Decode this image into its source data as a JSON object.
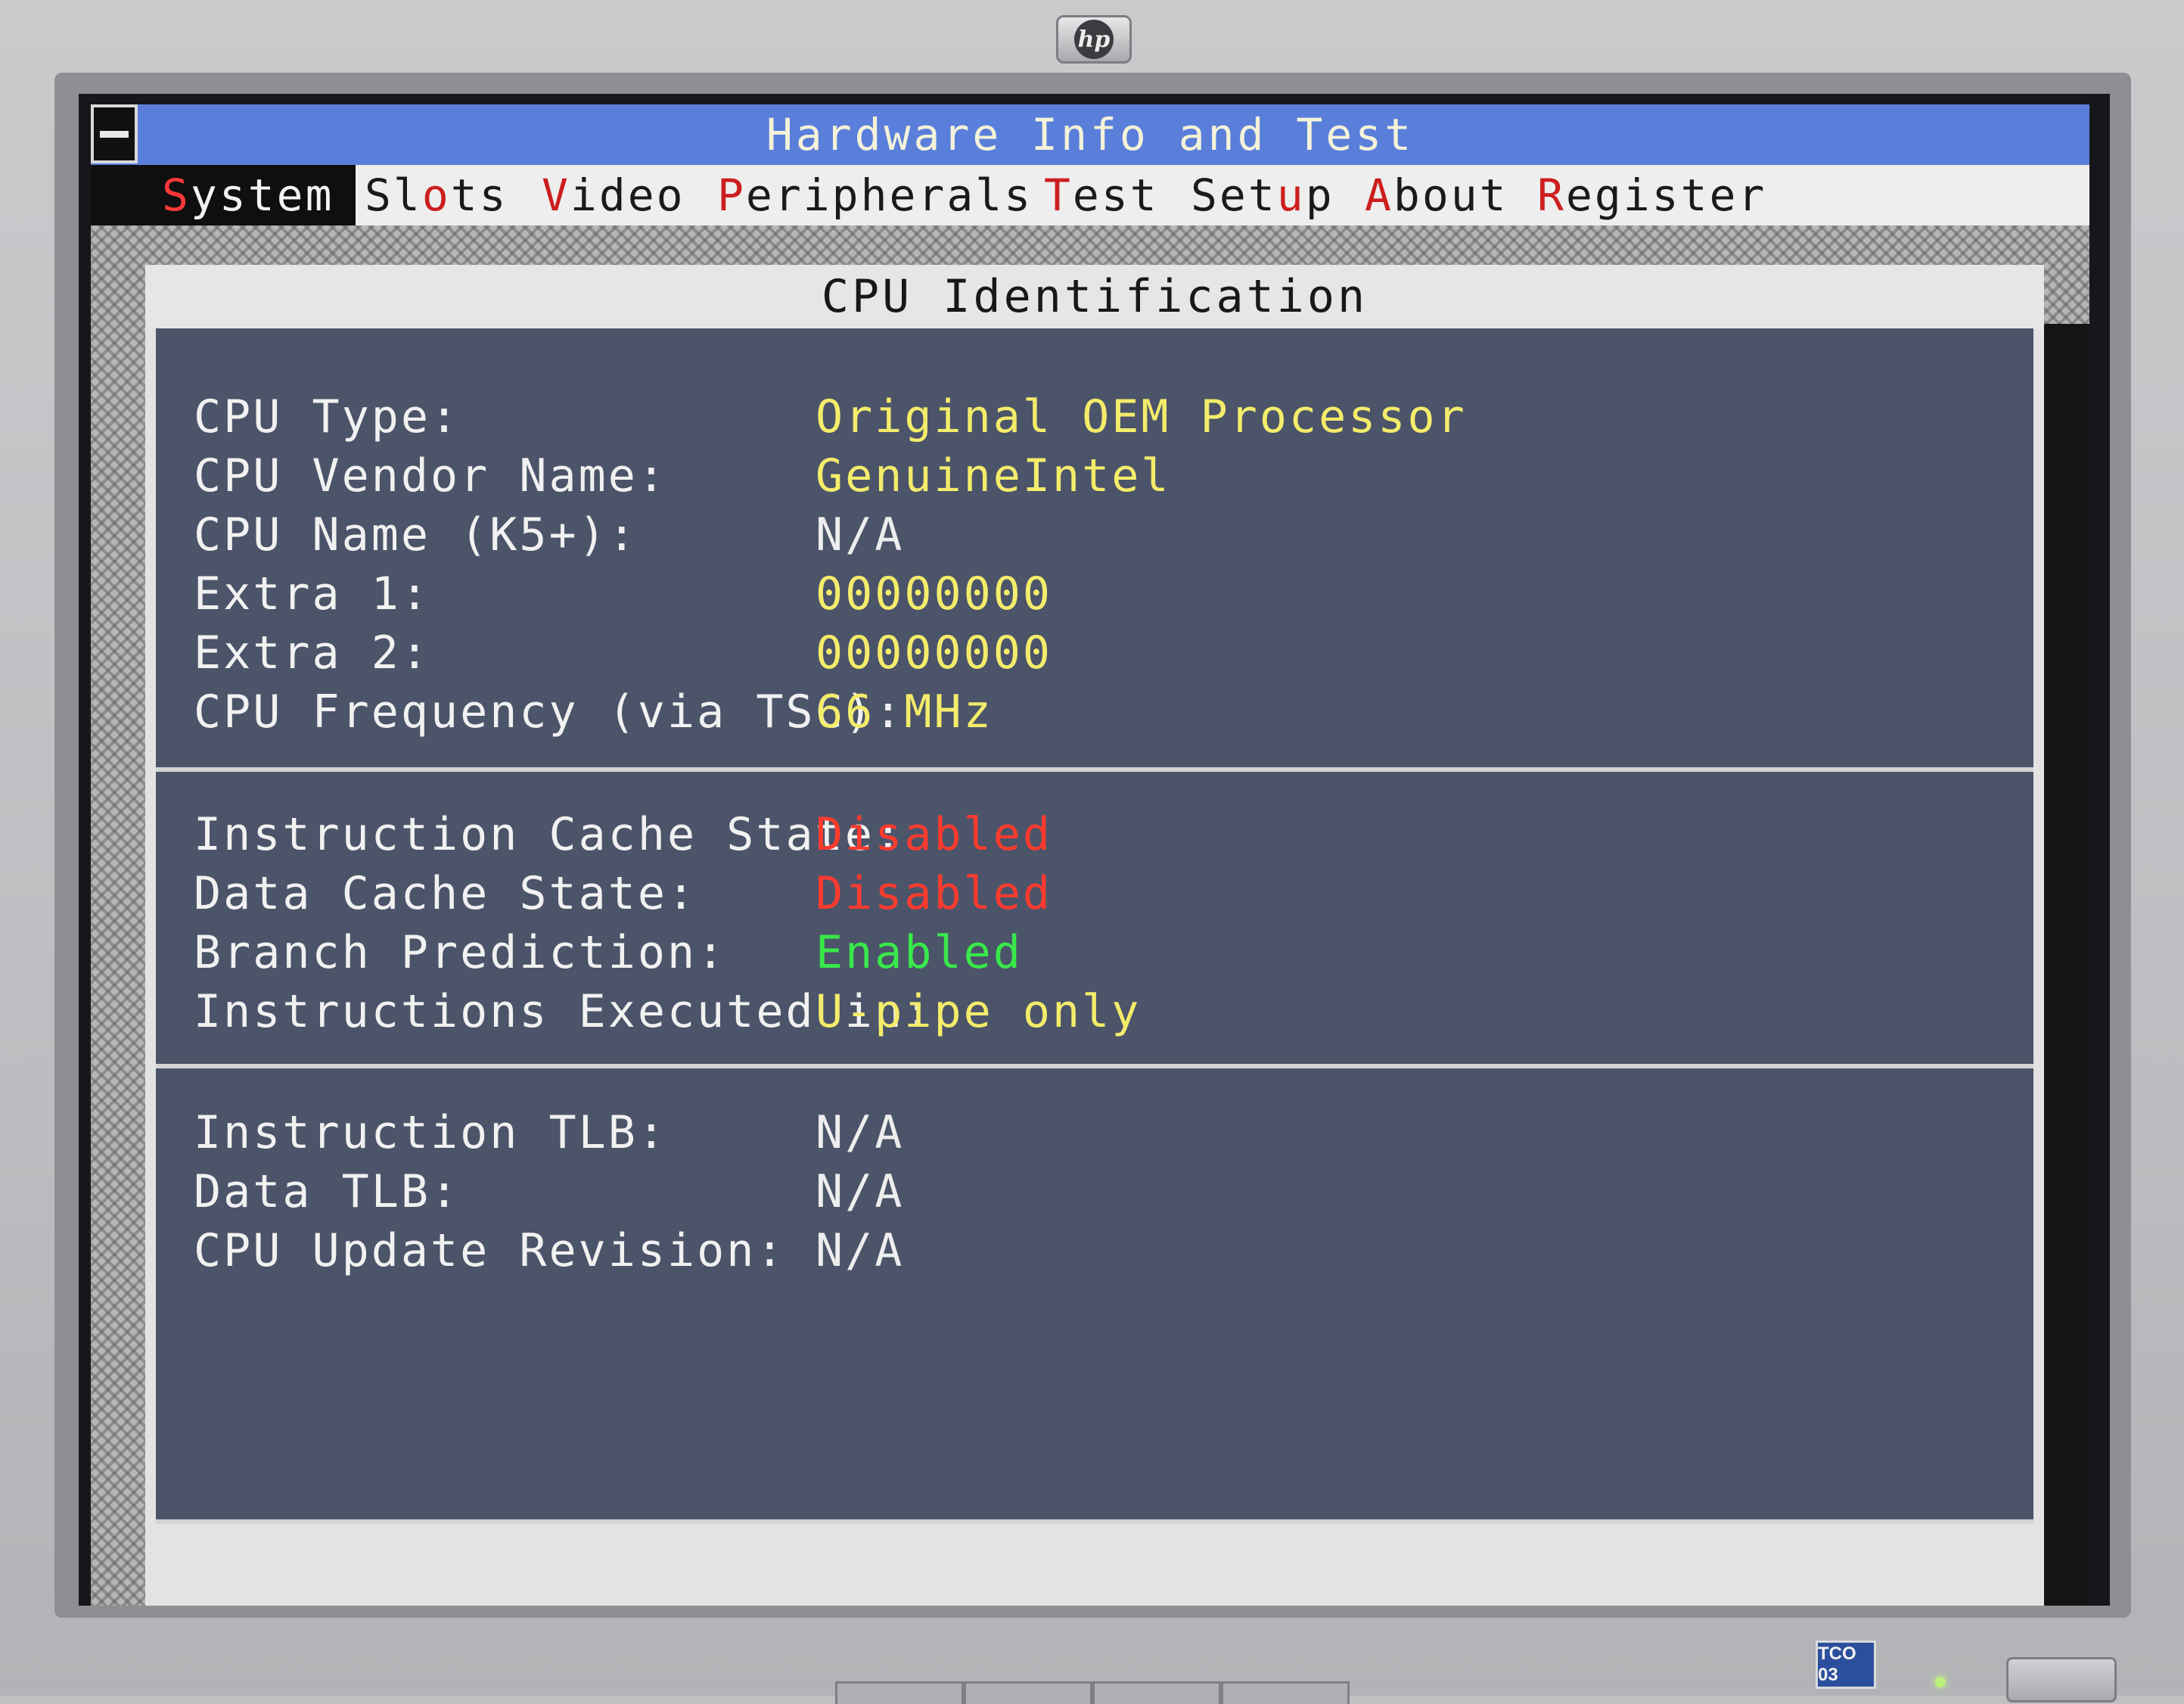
{
  "window": {
    "title": "Hardware Info and Test"
  },
  "menu": {
    "items": [
      {
        "hot": "S",
        "rest": "ystem"
      },
      {
        "hot": "",
        "rest": "Sl",
        "hot2": "o",
        "rest2": "ts"
      },
      {
        "hot": "V",
        "rest": "ideo"
      },
      {
        "hot": "P",
        "rest": "eripherals"
      },
      {
        "hot": "T",
        "rest": "est"
      },
      {
        "hot": "",
        "rest": "Set",
        "hot2": "u",
        "rest2": "p"
      },
      {
        "hot": "A",
        "rest": "bout"
      },
      {
        "hot": "R",
        "rest": "egister"
      }
    ],
    "active": "System"
  },
  "panel": {
    "title": "CPU Identification",
    "sections": [
      {
        "rows": [
          {
            "label": "CPU Type:",
            "value": "Original OEM Processor",
            "color": "yellow"
          },
          {
            "label": "CPU Vendor Name:",
            "value": "GenuineIntel",
            "color": "yellow"
          },
          {
            "label": "CPU Name (K5+):",
            "value": "N/A",
            "color": "white"
          },
          {
            "label": "Extra 1:",
            "value": "00000000",
            "color": "yellow"
          },
          {
            "label": "Extra 2:",
            "value": "00000000",
            "color": "yellow"
          },
          {
            "label": "CPU Frequency (via TSC):",
            "value": "66 MHz",
            "color": "yellow"
          }
        ]
      },
      {
        "rows": [
          {
            "label": "Instruction Cache State:",
            "value": "Disabled",
            "color": "red"
          },
          {
            "label": "Data Cache State:",
            "value": "Disabled",
            "color": "red"
          },
          {
            "label": "Branch Prediction:",
            "value": "Enabled",
            "color": "green"
          },
          {
            "label": "Instructions Executed in:",
            "value": "U-pipe only",
            "color": "yellow"
          }
        ]
      },
      {
        "rows": [
          {
            "label": "Instruction TLB:",
            "value": "N/A",
            "color": "white"
          },
          {
            "label": "Data TLB:",
            "value": "N/A",
            "color": "white"
          },
          {
            "label": "CPU Update Revision:",
            "value": "N/A",
            "color": "white"
          }
        ]
      }
    ]
  },
  "monitor": {
    "logo": "hp",
    "badge": "TCO 03"
  },
  "colors": {
    "title_bar": "#5a7fdb",
    "panel_body": "#4b5469",
    "value_yellow": "#f4ec6a",
    "value_red": "#ff3b2e",
    "value_green": "#39e84a",
    "hotkey_red": "#cc1e1e"
  }
}
